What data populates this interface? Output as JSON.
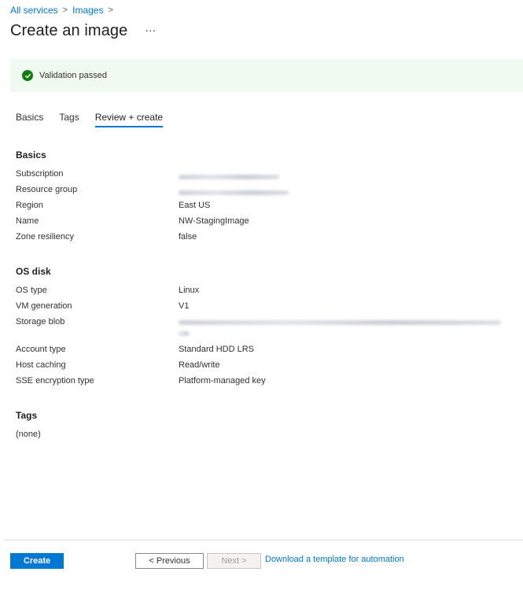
{
  "breadcrumb": {
    "items": [
      "All services",
      "Images"
    ],
    "separator": ">"
  },
  "header": {
    "title": "Create an image",
    "more_label": "···"
  },
  "validation": {
    "text": "Validation passed",
    "icon": "check-circle-icon",
    "color": "#107c10",
    "background": "#f1faf1"
  },
  "tabs": [
    {
      "label": "Basics",
      "active": false
    },
    {
      "label": "Tags",
      "active": false
    },
    {
      "label": "Review + create",
      "active": true
    }
  ],
  "sections": {
    "basics": {
      "heading": "Basics",
      "rows": [
        {
          "label": "Subscription",
          "value": null
        },
        {
          "label": "Resource group",
          "value": null
        },
        {
          "label": "Region",
          "value": "East US"
        },
        {
          "label": "Name",
          "value": "NW-StagingImage"
        },
        {
          "label": "Zone resiliency",
          "value": "false"
        }
      ]
    },
    "os_disk": {
      "heading": "OS disk",
      "rows": [
        {
          "label": "OS type",
          "value": "Linux"
        },
        {
          "label": "VM generation",
          "value": "V1"
        },
        {
          "label": "Storage blob",
          "value": null
        },
        {
          "label": "Account type",
          "value": "Standard HDD LRS"
        },
        {
          "label": "Host caching",
          "value": "Read/write"
        },
        {
          "label": "SSE encryption type",
          "value": "Platform-managed key"
        }
      ]
    },
    "tags": {
      "heading": "Tags",
      "value": "(none)"
    }
  },
  "footer": {
    "create_label": "Create",
    "previous_label": "< Previous",
    "next_label": "Next >",
    "download_label": "Download a template for automation"
  },
  "colors": {
    "accent": "#0078d4",
    "success": "#107c10"
  }
}
